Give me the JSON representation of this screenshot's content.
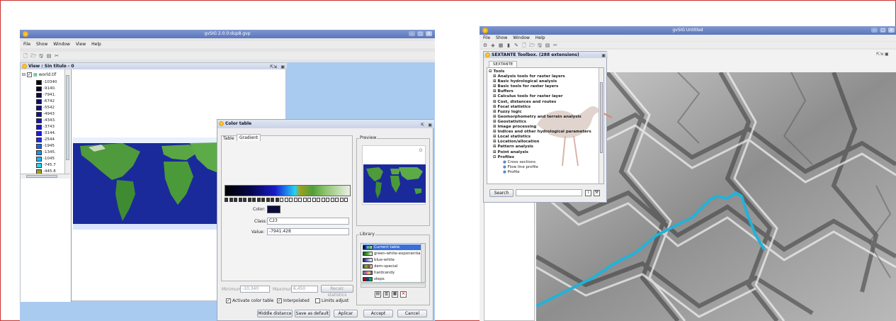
{
  "gvsig": {
    "title": "gvSIG 2.0.0:dup8.gvp",
    "menu": [
      "File",
      "Show",
      "Window",
      "View",
      "Help"
    ],
    "view_title": "View : Sin titulo - 0",
    "layer_name": "world.tif",
    "legend": [
      {
        "label": "-10340",
        "color": "#000000"
      },
      {
        "label": "-9140.",
        "color": "#050528"
      },
      {
        "label": "-7941.",
        "color": "#0a0a46"
      },
      {
        "label": "-6742",
        "color": "#0d0d64"
      },
      {
        "label": "-5542",
        "color": "#121282"
      },
      {
        "label": "-4943",
        "color": "#14149b"
      },
      {
        "label": "-4343.",
        "color": "#1616b4"
      },
      {
        "label": "-3743",
        "color": "#1a1ac8"
      },
      {
        "label": "-3144.",
        "color": "#1c1cdc"
      },
      {
        "label": "-2544",
        "color": "#1e28f0"
      },
      {
        "label": "-1945",
        "color": "#1e64f0"
      },
      {
        "label": "-1345.",
        "color": "#1e8cf0"
      },
      {
        "label": "-1045",
        "color": "#1eb4f0"
      },
      {
        "label": "-745.7",
        "color": "#28d2f0"
      },
      {
        "label": "-445.8",
        "color": "#9ea020"
      }
    ]
  },
  "color_table": {
    "title": "Color table",
    "tabs": [
      "Table",
      "Gradient"
    ],
    "preview_label": "Preview",
    "color_label": "Color:",
    "color_value": "#0a0a3c",
    "class_label": "Class:",
    "class_value": "C23",
    "value_label": "Value:",
    "value_value": "-7941.428",
    "library_label": "Library",
    "library": [
      {
        "label": "Current table",
        "selected": true
      },
      {
        "label": "green-white-exponential",
        "selected": false
      },
      {
        "label": "blue-white",
        "selected": false
      },
      {
        "label": "dem-special",
        "selected": false
      },
      {
        "label": "hardcandy",
        "selected": false
      },
      {
        "label": "steps",
        "selected": false
      }
    ],
    "minimum_label": "Minimum",
    "minimum_value": "-10,340",
    "maximum_label": "Maximum",
    "maximum_value": "6,450",
    "recalc_label": "Recalc statistics",
    "activate_label": "Activate color table",
    "activate_checked": true,
    "interpolated_label": "Interpolated",
    "interpolated_checked": true,
    "limits_label": "Limits adjust",
    "limits_checked": false,
    "buttons": [
      "Middle distance",
      "Save as default",
      "Aplicar",
      "Accept",
      "Cancel"
    ]
  },
  "sextante_app": {
    "title": "gvSIG Untitled",
    "menu": [
      "File",
      "Show",
      "Window",
      "Help"
    ]
  },
  "sextante": {
    "title": "SEXTANTE Toolbox. (288 extensions)",
    "tab": "SEXTANTE",
    "root": "Tools",
    "items": [
      "Analysis tools for raster layers",
      "Basic hydrological analysis",
      "Basic tools for raster layers",
      "Buffers",
      "Calculus tools for raster layer",
      "Cost, distances and routes",
      "Focal statistics",
      "Fuzzy logic",
      "Geomorphometry and terrain analysis",
      "Geostatistics",
      "Image processing",
      "Indices and other hydrological parameters",
      "Local statistics",
      "Location/allocation",
      "Pattern analysis",
      "Point analysis",
      "Profiles"
    ],
    "subitems": [
      "Cross sections",
      "Flow line profile",
      "Profile"
    ],
    "search_label": "Search",
    "search_value": ""
  }
}
